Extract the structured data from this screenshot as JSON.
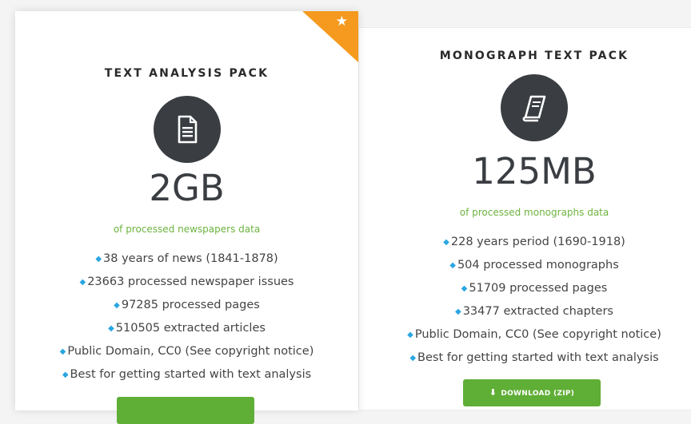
{
  "cards": [
    {
      "title": "TEXT ANALYSIS PACK",
      "icon": "document-icon",
      "featured": true,
      "size": "2GB",
      "subtitle": "of processed newspapers data",
      "features": [
        "38 years of news (1841-1878)",
        "23663 processed newspaper issues",
        "97285 processed pages",
        "510505 extracted articles",
        "Public Domain, CC0 (See copyright notice)",
        "Best for getting started with text analysis"
      ],
      "button_label": ""
    },
    {
      "title": "MONOGRAPH TEXT PACK",
      "icon": "book-icon",
      "featured": false,
      "size": "125MB",
      "subtitle": "of processed monographs data",
      "features": [
        "228 years period (1690-1918)",
        "504 processed monographs",
        "51709 processed pages",
        "33477 extracted chapters",
        "Public Domain, CC0 (See copyright notice)",
        "Best for getting started with text analysis"
      ],
      "button_label": "DOWNLOAD (ZIP)"
    }
  ],
  "colors": {
    "accent_green": "#6db33f",
    "button_green": "#5fae36",
    "ribbon_orange": "#f59a1e",
    "bullet_blue": "#2aa6e0",
    "icon_circle": "#3a3d42"
  }
}
